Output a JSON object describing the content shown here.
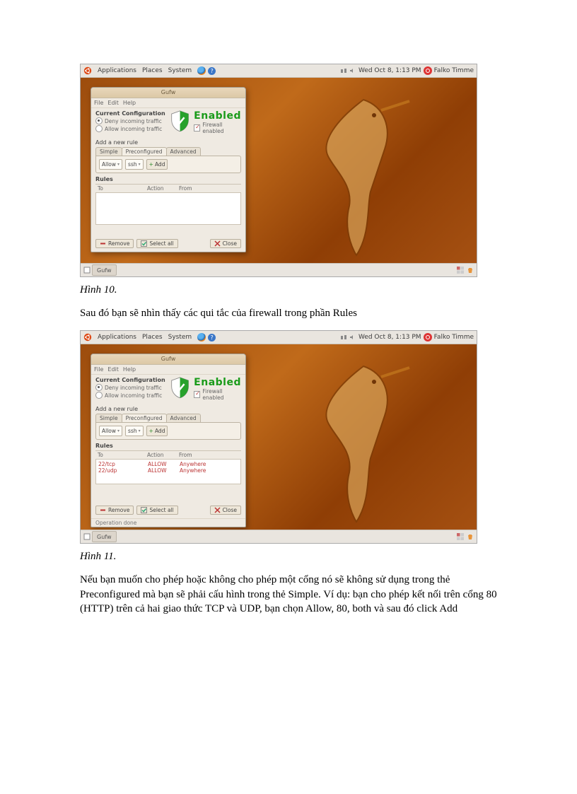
{
  "captions": {
    "fig10": "Hình 10.",
    "fig11": "Hình 11."
  },
  "paragraphs": {
    "p1": "Sau đó bạn sẽ nhìn thấy các qui tắc của firewall trong phần Rules",
    "p2": "Nếu bạn muốn cho phép hoặc không cho phép một cổng nó sẽ không sử dụng trong thẻ Preconfigured mà bạn sẽ phải cấu hình trong thẻ Simple. Ví dụ: bạn cho phép kết nối trên cổng 80 (HTTP) trên cả hai giao thức TCP và UDP, bạn chọn Allow, 80, both và sau đó click Add"
  },
  "top_panel": {
    "menus": [
      "Applications",
      "Places",
      "System"
    ],
    "tray": {
      "net_icon": "network-idle-icon",
      "vol_icon": "volume-icon",
      "datetime": "Wed Oct  8, 1:13 PM",
      "user": "Falko Timme"
    }
  },
  "bottom_panel": {
    "task": "Gufw"
  },
  "gufw": {
    "title": "Gufw",
    "menus": [
      "File",
      "Edit",
      "Help"
    ],
    "config_title": "Current Configuration",
    "radio_deny": "Deny incoming traffic",
    "radio_allow": "Allow incoming traffic",
    "enabled": "Enabled",
    "firewall_enabled": "Firewall enabled",
    "add_rule_title": "Add a new rule",
    "tabs": [
      "Simple",
      "Preconfigured",
      "Advanced"
    ],
    "allow_option": "Allow",
    "service_option": "ssh",
    "add_btn": "Add",
    "rules_title": "Rules",
    "rules_head": {
      "to": "To",
      "action": "Action",
      "from": "From"
    },
    "buttons": {
      "remove": "Remove",
      "select_all": "Select all",
      "close": "Close"
    }
  },
  "gufw2": {
    "rules": [
      {
        "to": "22/tcp",
        "action": "ALLOW",
        "from": "Anywhere"
      },
      {
        "to": "22/udp",
        "action": "ALLOW",
        "from": "Anywhere"
      }
    ],
    "statusbar": "Operation done"
  }
}
